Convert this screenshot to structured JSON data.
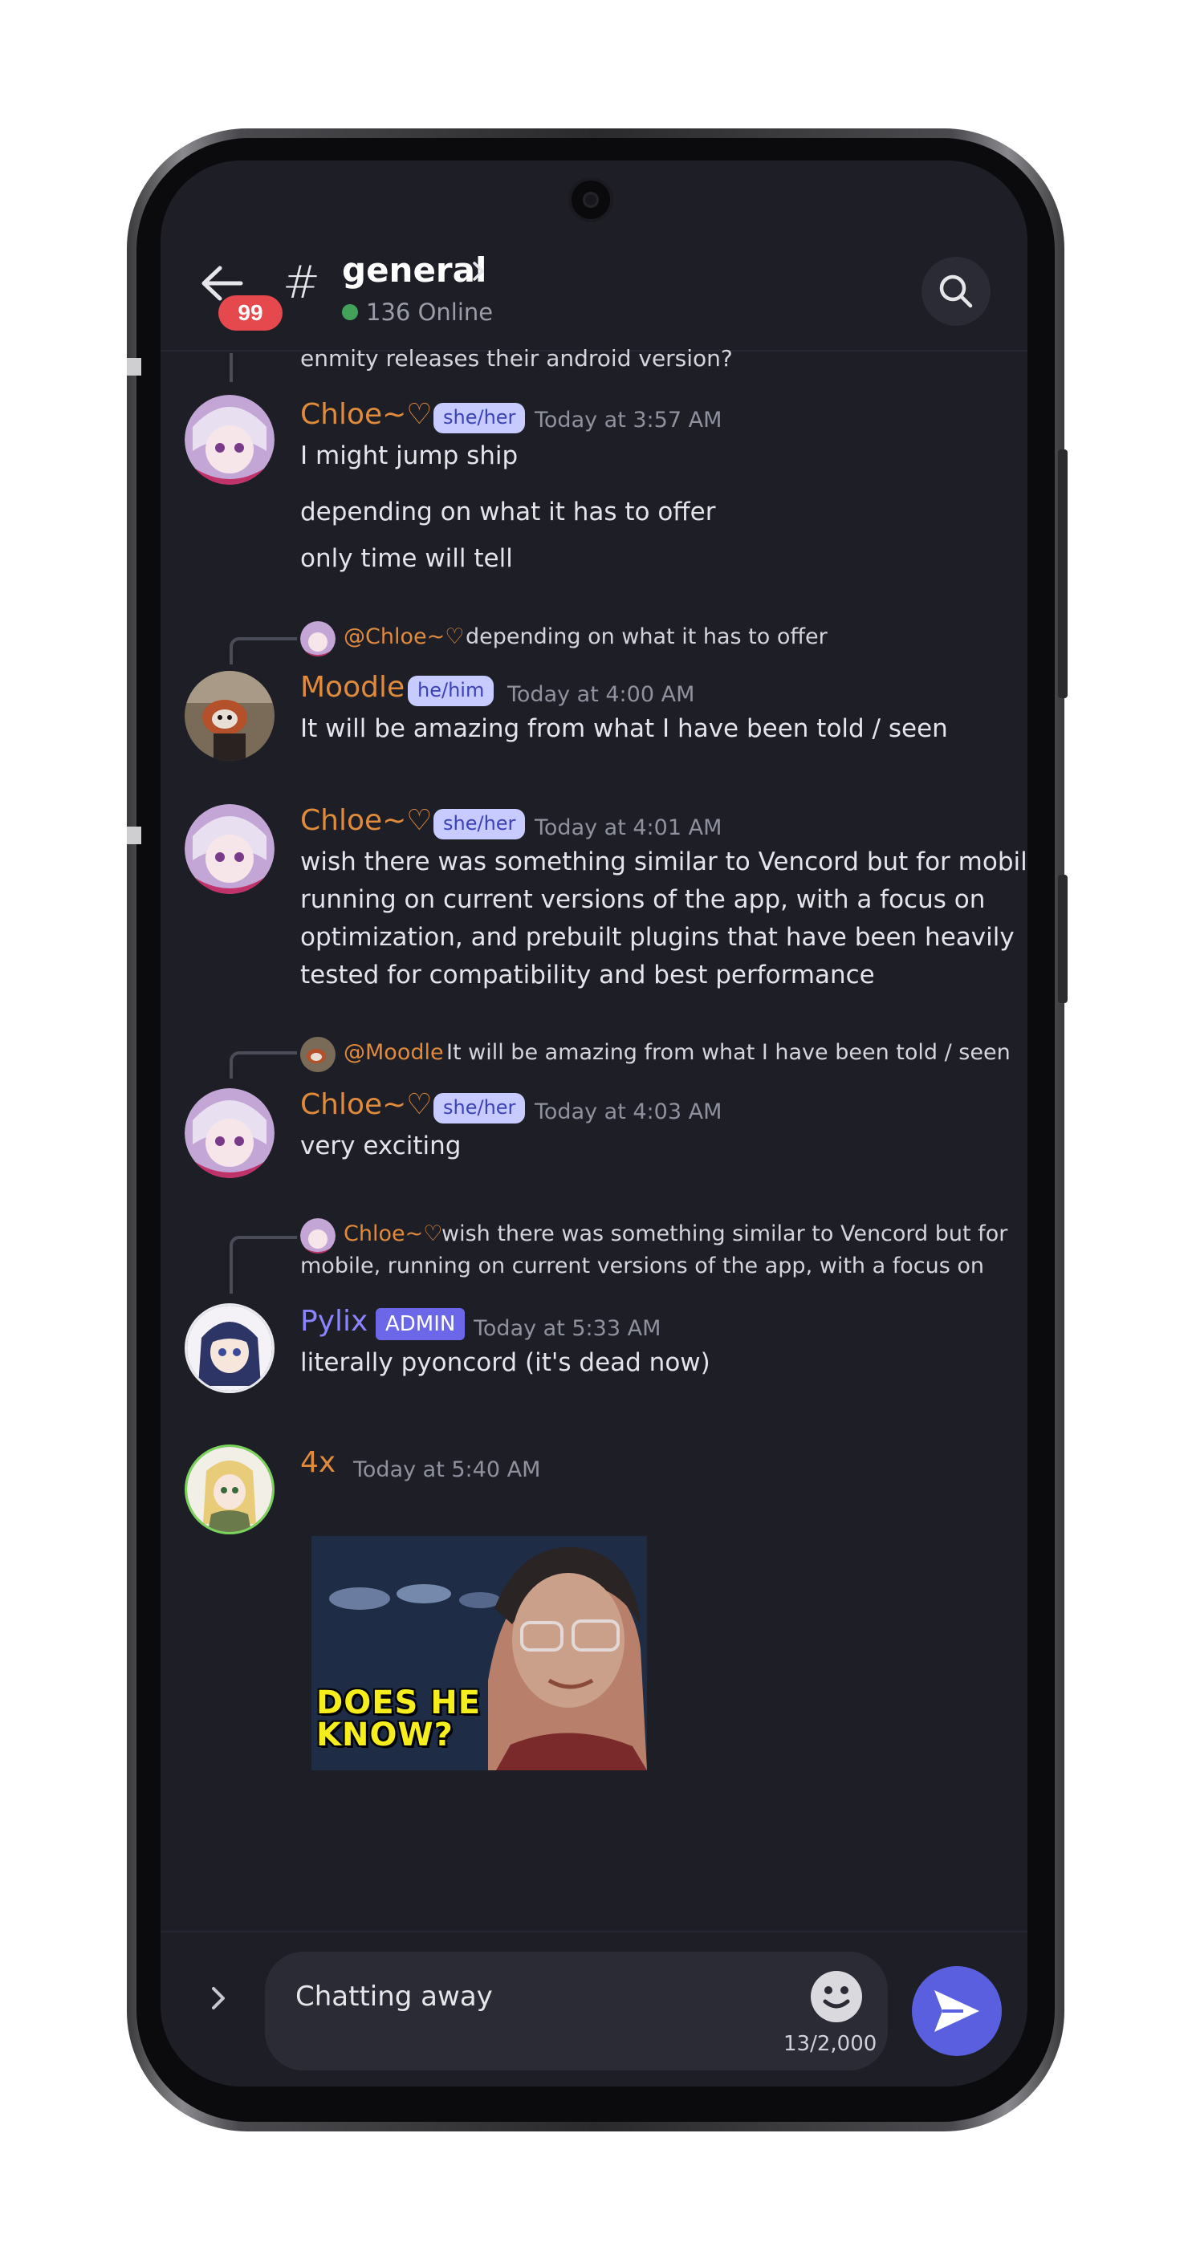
{
  "header": {
    "unread_count": "99",
    "channel_name": "general",
    "online_status": "136 Online"
  },
  "messages": [
    {
      "truncated_text": "enmity releases their android version?"
    },
    {
      "author": "Chloe~♡",
      "pronouns": "she/her",
      "timestamp": "Today at 3:57 AM",
      "lines": [
        "I might jump ship",
        "depending on what it has to offer",
        "only time will tell"
      ]
    },
    {
      "reply_to_name": "@Chloe~♡",
      "reply_to_text": "depending on what it has to offer",
      "author": "Moodle",
      "pronouns": "he/him",
      "timestamp": "Today at 4:00 AM",
      "lines": [
        "It will be amazing from what I have been told / seen"
      ]
    },
    {
      "author": "Chloe~♡",
      "pronouns": "she/her",
      "timestamp": "Today at 4:01 AM",
      "lines": [
        "wish there was something similar to Vencord but for mobile,",
        "running on current versions of the app, with a focus on",
        "optimization, and prebuilt plugins that have been heavily",
        "tested for compatibility and best performance"
      ]
    },
    {
      "reply_to_name": "@Moodle",
      "reply_to_text": "It will be amazing from what I have been told / seen",
      "author": "Chloe~♡",
      "pronouns": "she/her",
      "timestamp": "Today at 4:03 AM",
      "lines": [
        "very exciting"
      ]
    },
    {
      "reply_to_name": "Chloe~♡",
      "reply_to_text_line1": "wish there was something similar to Vencord but for",
      "reply_to_text_line2": "mobile, running on current versions of the app, with a focus on",
      "author": "Pylix",
      "role_badge": "ADMIN",
      "timestamp": "Today at 5:33 AM",
      "lines": [
        "literally pyoncord (it's dead now)"
      ]
    },
    {
      "author": "4x",
      "timestamp": "Today at 5:40 AM",
      "gif_caption_line1": "DOES HE",
      "gif_caption_line2": "KNOW?"
    }
  ],
  "composer": {
    "value": "Chatting away",
    "char_count": "13/2,000"
  },
  "colors": {
    "background": "#1d1e26",
    "name_orange": "#e08a3c",
    "name_admin": "#8a85ff",
    "pronoun_pill": "#c7cbff",
    "send_button": "#5a5fe0",
    "badge_red": "#e5484d",
    "online_green": "#43a25a"
  },
  "icons": [
    "back-arrow-icon",
    "hash-icon",
    "chevron-right-icon",
    "search-icon",
    "expand-chevron-icon",
    "emoji-icon",
    "send-icon"
  ]
}
